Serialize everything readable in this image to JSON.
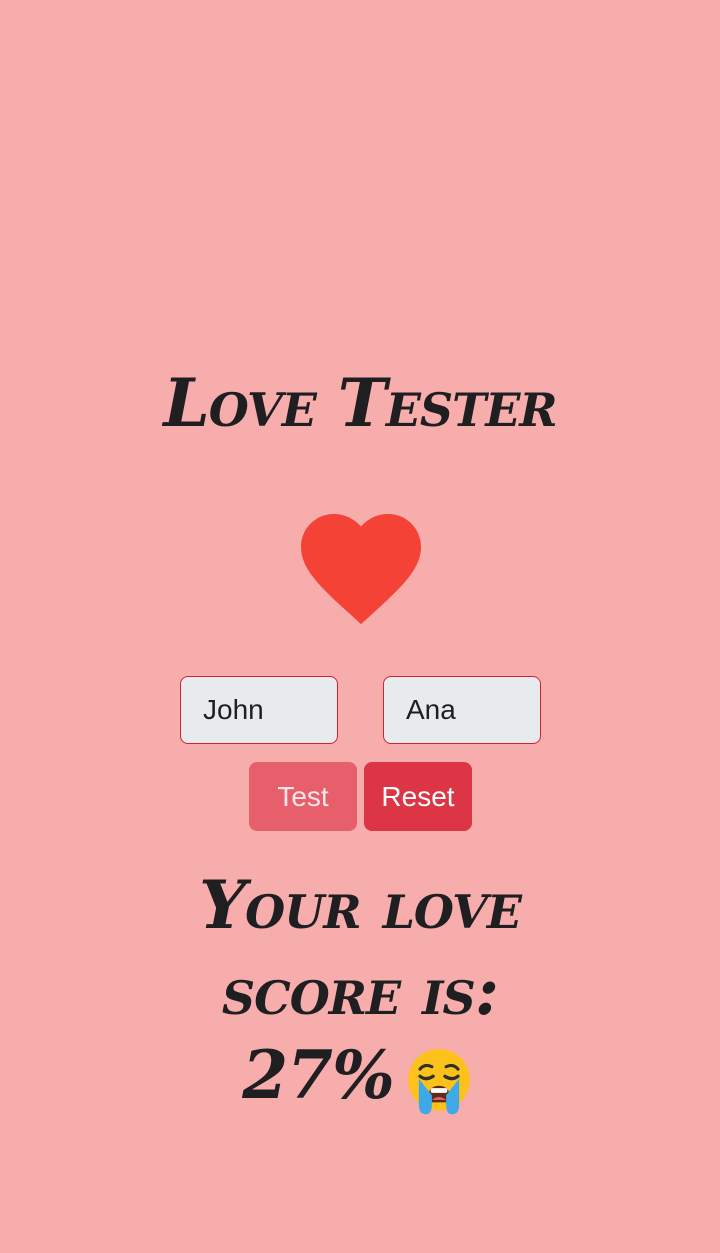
{
  "app": {
    "title": "Love Tester"
  },
  "form": {
    "name1_value": "John",
    "name2_value": "Ana",
    "test_label": "Test",
    "reset_label": "Reset"
  },
  "result": {
    "line1": "Your love",
    "line2": "score is:",
    "score": "27%",
    "emoji_icon": "crying-face-icon"
  },
  "icons": {
    "heart": "heart-icon"
  },
  "colors": {
    "background": "#f8adad",
    "heart": "#f44336",
    "input_bg": "#e8ebee",
    "input_border": "#d7202f",
    "test_button": "#e85f6c",
    "reset_button": "#dc3545",
    "text": "#1f1f22"
  }
}
